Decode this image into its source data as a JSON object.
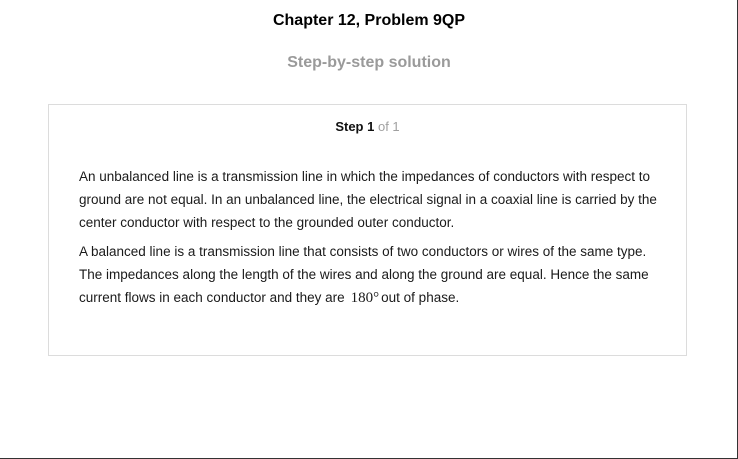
{
  "header": {
    "chapter_title": "Chapter 12, Problem 9QP",
    "subtitle": "Step-by-step solution"
  },
  "step": {
    "label": "Step 1",
    "count": "of 1",
    "paragraph1": "An unbalanced line is a transmission line in which the impedances of conductors with respect to ground are not equal. In an unbalanced line, the electrical signal in a coaxial line is carried by the center conductor with respect to the grounded outer conductor.",
    "paragraph2_before": "A balanced line is a transmission line that consists of two conductors or wires of the same type. The impedances along the length of the wires and along the ground are equal. Hence the same current flows in each conductor and they are",
    "paragraph2_math": "180°",
    "paragraph2_after": "out of phase."
  }
}
